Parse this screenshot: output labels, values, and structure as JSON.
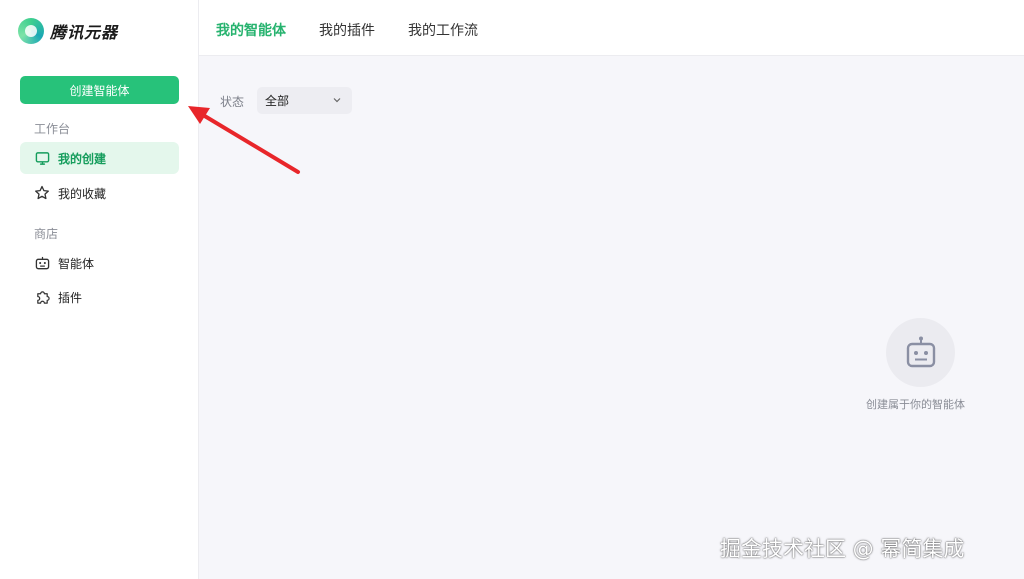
{
  "brand": {
    "name": "腾讯元器",
    "icon": "logo-icon",
    "accent": "#27c27a"
  },
  "sidebar": {
    "create_button": "创建智能体",
    "sections": [
      {
        "title": "工作台",
        "items": [
          {
            "label": "我的创建",
            "icon": "monitor-icon",
            "active": true
          },
          {
            "label": "我的收藏",
            "icon": "star-icon",
            "active": false
          }
        ]
      },
      {
        "title": "商店",
        "items": [
          {
            "label": "智能体",
            "icon": "robot-icon",
            "active": false
          },
          {
            "label": "插件",
            "icon": "puzzle-icon",
            "active": false
          }
        ]
      }
    ]
  },
  "header": {
    "tabs": [
      {
        "label": "我的智能体",
        "active": true
      },
      {
        "label": "我的插件",
        "active": false
      },
      {
        "label": "我的工作流",
        "active": false
      }
    ]
  },
  "filter": {
    "label": "状态",
    "value": "全部"
  },
  "empty_state": {
    "icon": "robot-icon",
    "text": "创建属于你的智能体"
  },
  "watermark": "掘金技术社区 @ 幂简集成",
  "annotation": {
    "icon": "red-arrow",
    "color": "#e8262a"
  }
}
